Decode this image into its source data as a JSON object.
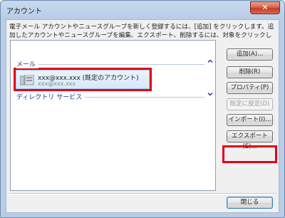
{
  "window": {
    "title": "アカウント",
    "close_symbol": "✕"
  },
  "description": "電子メール アカウントやニュースグループを新しく登録するには、[追加] をクリックします。追加したアカウントやニュースグループを編集、エクスポート、削除するには、対象をクリックしてから、希望の動作をクリックします。",
  "groups": {
    "mail": {
      "label": "メール"
    },
    "directory": {
      "label": "ディレクトリ サービス"
    }
  },
  "account": {
    "name": "xxx@xxx.xxx (既定のアカウント)",
    "sub": "xxx@xxx.xxx"
  },
  "buttons": {
    "add": "追加(A)...",
    "delete": "削除(R)",
    "properties": "プロパティ(P)",
    "set_default": "既定に設定(D)",
    "import": "インポート(I)...",
    "export": "エクスポート(E)...",
    "close": "閉じる"
  },
  "colors": {
    "highlight": "#e0001b",
    "selection": "#d7e8fa"
  }
}
